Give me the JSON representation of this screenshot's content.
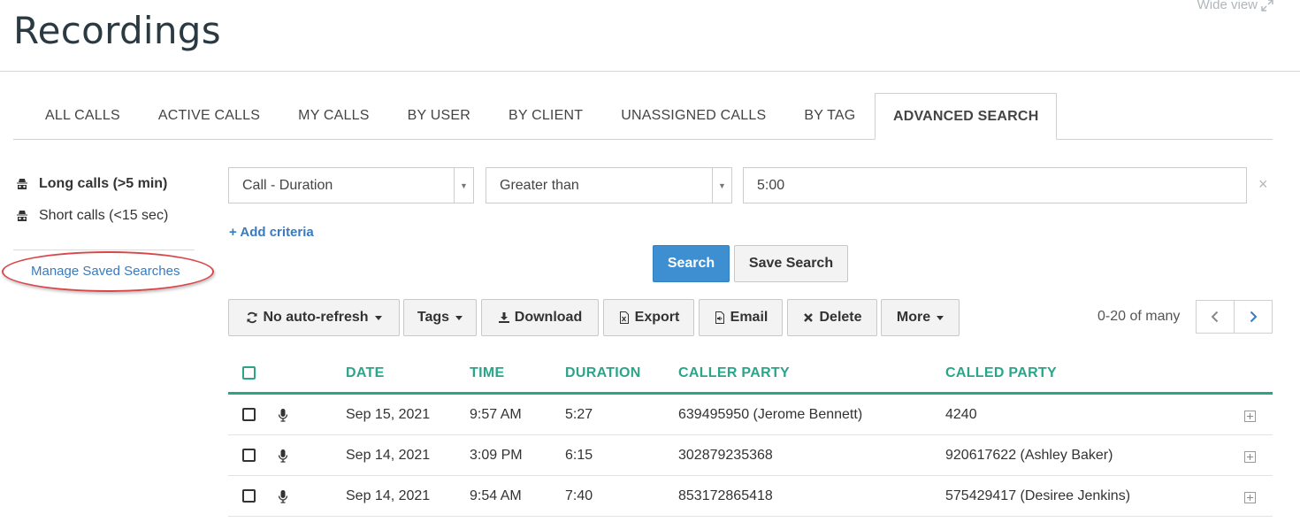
{
  "page": {
    "title": "Recordings",
    "wide_view_label": "Wide view"
  },
  "tabs": [
    {
      "label": "ALL CALLS",
      "active": false
    },
    {
      "label": "ACTIVE CALLS",
      "active": false
    },
    {
      "label": "MY CALLS",
      "active": false
    },
    {
      "label": "BY USER",
      "active": false
    },
    {
      "label": "BY CLIENT",
      "active": false
    },
    {
      "label": "UNASSIGNED CALLS",
      "active": false
    },
    {
      "label": "BY TAG",
      "active": false
    },
    {
      "label": "ADVANCED SEARCH",
      "active": true
    }
  ],
  "sidebar": {
    "saved_searches": [
      {
        "label": "Long calls (>5 min)",
        "selected": true,
        "icon": "spy-icon"
      },
      {
        "label": "Short calls (<15 sec)",
        "selected": false,
        "icon": "spy-icon"
      }
    ],
    "manage_link": "Manage Saved Searches"
  },
  "criteria": {
    "field_select": "Call - Duration",
    "operator_select": "Greater than",
    "value": "5:00",
    "add_criteria_label": "Add criteria"
  },
  "search_actions": {
    "search_label": "Search",
    "save_search_label": "Save Search"
  },
  "toolbar": {
    "refresh_label": "No auto-refresh",
    "tags_label": "Tags",
    "download_label": "Download",
    "export_label": "Export",
    "email_label": "Email",
    "delete_label": "Delete",
    "more_label": "More",
    "paging_text": "0-20 of many"
  },
  "table": {
    "columns": [
      "DATE",
      "TIME",
      "DURATION",
      "CALLER PARTY",
      "CALLED PARTY"
    ],
    "rows": [
      {
        "date": "Sep 15, 2021",
        "time": "9:57 AM",
        "duration": "5:27",
        "caller": "639495950 (Jerome Bennett)",
        "called": "4240"
      },
      {
        "date": "Sep 14, 2021",
        "time": "3:09 PM",
        "duration": "6:15",
        "caller": "302879235368",
        "called": "920617622 (Ashley Baker)"
      },
      {
        "date": "Sep 14, 2021",
        "time": "9:54 AM",
        "duration": "7:40",
        "caller": "853172865418",
        "called": "575429417 (Desiree Jenkins)"
      }
    ]
  },
  "colors": {
    "accent_green": "#2aa58a",
    "primary_blue": "#3d8fd1",
    "link_blue": "#3a7abf",
    "highlight_red": "#d9474a"
  }
}
